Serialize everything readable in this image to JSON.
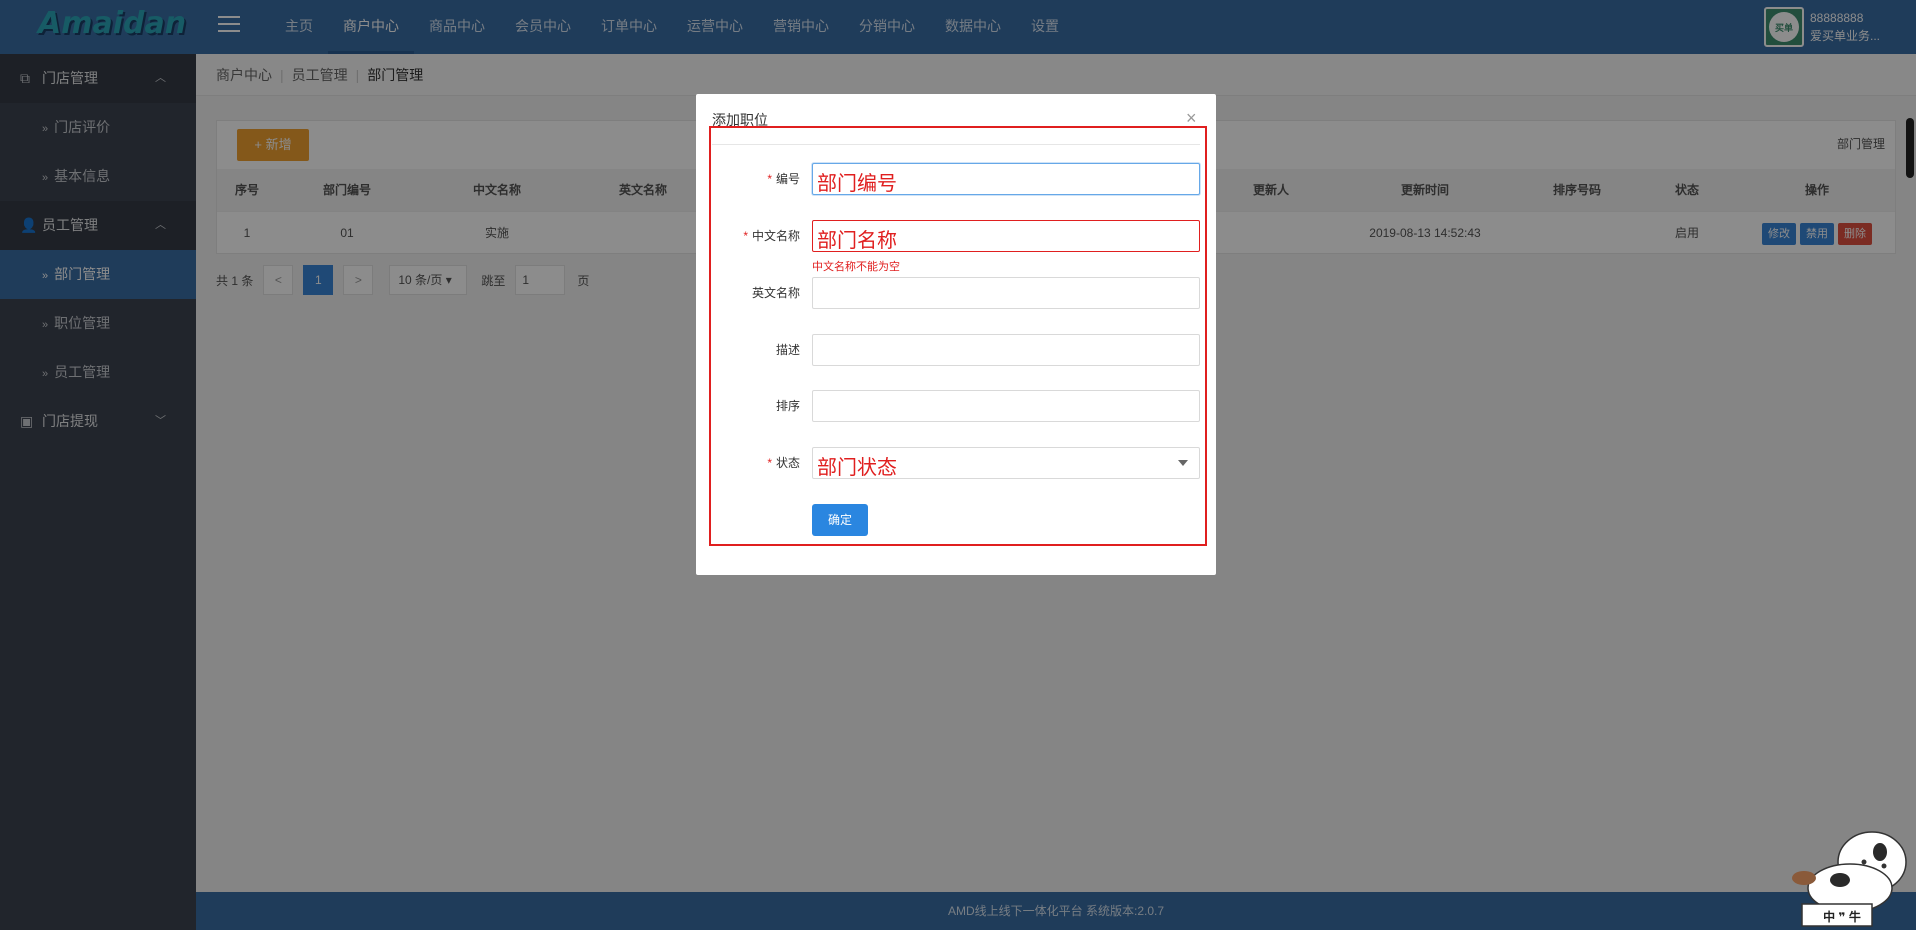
{
  "header": {
    "logo": "Amaidan",
    "nav": [
      "主页",
      "商户中心",
      "商品中心",
      "会员中心",
      "订单中心",
      "运营中心",
      "营销中心",
      "分销中心",
      "数据中心",
      "设置"
    ],
    "active_nav_index": 1,
    "user": {
      "avatar_text": "买单",
      "id": "88888888",
      "name": "爱买单业务..."
    }
  },
  "sidebar": {
    "groups": [
      {
        "label": "门店管理",
        "items": [
          "门店评价",
          "基本信息"
        ]
      },
      {
        "label": "员工管理",
        "items": [
          "部门管理",
          "职位管理",
          "员工管理"
        ]
      },
      {
        "label": "门店提现",
        "items": []
      }
    ],
    "active_item": "部门管理"
  },
  "breadcrumb": [
    "商户中心",
    "员工管理",
    "部门管理"
  ],
  "table": {
    "add_button": "+ 新增",
    "title": "部门管理",
    "columns": [
      "序号",
      "部门编号",
      "中文名称",
      "英文名称",
      "更新人",
      "更新时间",
      "排序号码",
      "状态",
      "操作"
    ],
    "rows": [
      {
        "index": "1",
        "code": "01",
        "cn_name": "实施",
        "en_name": "",
        "updater": "",
        "updated_at": "2019-08-13 14:52:43",
        "sort": "",
        "status": "启用"
      }
    ],
    "actions": [
      "修改",
      "禁用",
      "删除"
    ]
  },
  "pager": {
    "total": "共 1 条",
    "prev": "<",
    "current": "1",
    "next": ">",
    "page_size": "10 条/页",
    "goto_label": "跳至",
    "goto_value": "1",
    "page_unit": "页"
  },
  "footer": "AMD线上线下一体化平台 系统版本:2.0.7",
  "modal": {
    "title": "添加职位",
    "close": "×",
    "fields": [
      {
        "label": "编号",
        "required": true,
        "annotation": "部门编号"
      },
      {
        "label": "中文名称",
        "required": true,
        "annotation": "部门名称",
        "error": "中文名称不能为空"
      },
      {
        "label": "英文名称",
        "required": false
      },
      {
        "label": "描述",
        "required": false
      },
      {
        "label": "排序",
        "required": false
      },
      {
        "label": "状态",
        "required": true,
        "annotation": "部门状态"
      }
    ],
    "submit": "确定"
  },
  "mascot": {
    "text": "中 ❞ 牛"
  },
  "colors": {
    "topbar": "#3a6ea5",
    "sidebar": "#3d4450",
    "accent": "#3a86d8",
    "danger": "#e01f1f",
    "warn": "#f0a030"
  }
}
